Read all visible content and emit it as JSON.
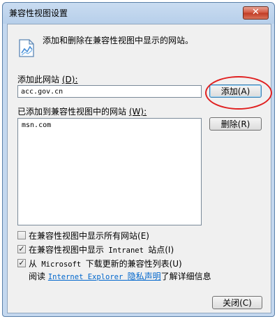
{
  "window": {
    "title": "兼容性视图设置",
    "close_glyph": "✕"
  },
  "info": {
    "icon": "compatibility-view-icon",
    "text": "添加和删除在兼容性视图中显示的网站。"
  },
  "add_site": {
    "label": "添加此网站",
    "accelerator": "(D):",
    "value": "acc.gov.cn",
    "add_button": "添加(A)"
  },
  "added_sites": {
    "label": "已添加到兼容性视图中的网站",
    "accelerator": "(W):",
    "items": [
      "msn.com"
    ],
    "remove_button": "删除(R)"
  },
  "options": [
    {
      "label_prefix": "在兼容性视图中显示所有网站",
      "label_mono": "",
      "label_suffix": "(E)",
      "checked": false
    },
    {
      "label_prefix": "在兼容性视图中显示",
      "label_mono": " Intranet ",
      "label_suffix": "站点(I)",
      "checked": true
    },
    {
      "label_prefix": "从",
      "label_mono": " Microsoft ",
      "label_suffix": "下载更新的兼容性列表(U)",
      "checked": true
    }
  ],
  "privacy": {
    "prefix": "阅读 ",
    "link_mono": "Internet Explorer ",
    "link_text": "隐私声明",
    "suffix": "了解详细信息"
  },
  "close_button": "关闭(C)",
  "colors": {
    "annotation": "#e02020",
    "link": "#0066cc",
    "titlebar": "#b7cfea"
  }
}
